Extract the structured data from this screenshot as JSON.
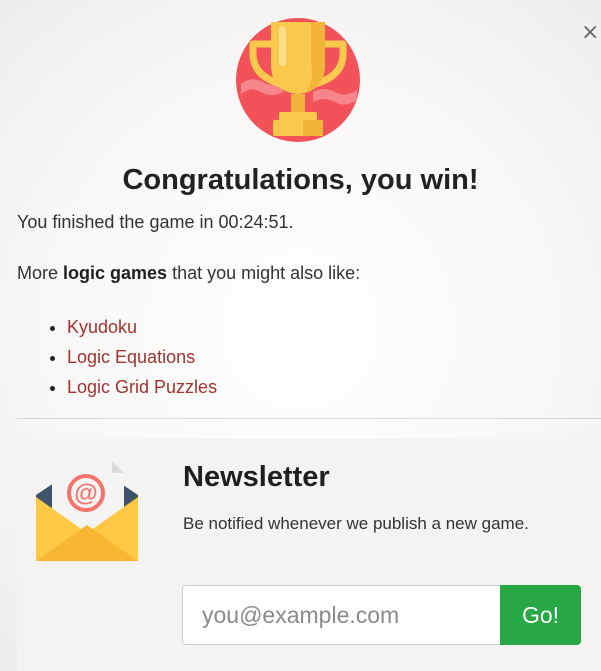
{
  "dialog": {
    "close_label": "×",
    "title": "Congratulations, you win!",
    "finish_text": "You finished the game in 00:24:51.",
    "more_prefix": "More",
    "more_bold": "logic games",
    "more_suffix": "that you might also like:",
    "games": [
      {
        "label": "Kyudoku"
      },
      {
        "label": "Logic Equations"
      },
      {
        "label": "Logic Grid Puzzles"
      }
    ]
  },
  "newsletter": {
    "title": "Newsletter",
    "description": "Be notified whenever we publish a new game.",
    "email_placeholder": "you@example.com",
    "go_label": "Go!"
  },
  "icons": {
    "trophy": "trophy-icon",
    "envelope": "email-envelope-icon",
    "close": "close-icon"
  },
  "colors": {
    "link": "#a3322e",
    "go_button": "#28a745",
    "trophy_circle": "#f4525a",
    "trophy_gold": "#f9c84c",
    "envelope_yellow": "#ffc845"
  }
}
